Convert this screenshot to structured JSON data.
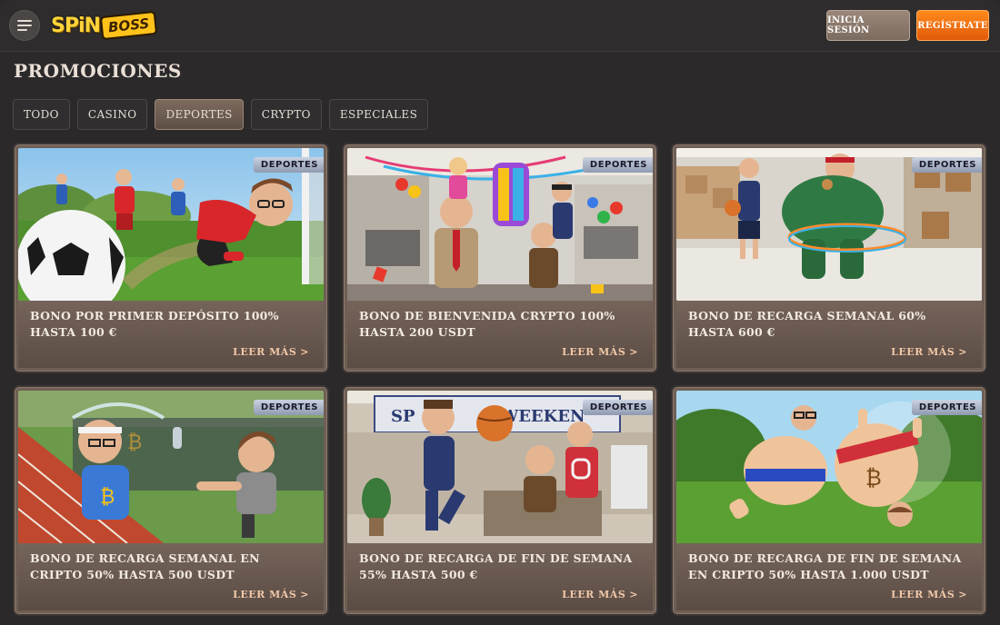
{
  "header": {
    "logo_main": "SPiN",
    "logo_sub": "BOSS",
    "login_label": "INICIA SESIÓN",
    "register_label": "REGÍSTRATE"
  },
  "page": {
    "title": "PROMOCIONES"
  },
  "tabs": [
    {
      "label": "TODO",
      "active": false
    },
    {
      "label": "CASINO",
      "active": false
    },
    {
      "label": "DEPORTES",
      "active": true
    },
    {
      "label": "CRYPTO",
      "active": false
    },
    {
      "label": "ESPECIALES",
      "active": false
    }
  ],
  "cards": [
    {
      "badge": "DEPORTES",
      "title": "BONO POR PRIMER DEPÓSITO 100% HASTA 100 €",
      "link": "LEER MÁS",
      "chev": ">"
    },
    {
      "badge": "DEPORTES",
      "title": "BONO DE BIENVENIDA CRYPTO 100% HASTA 200 USDT",
      "link": "LEER MÁS",
      "chev": ">"
    },
    {
      "badge": "DEPORTES",
      "title": "BONO DE RECARGA SEMANAL 60% HASTA 600 €",
      "link": "LEER MÁS",
      "chev": ">"
    },
    {
      "badge": "DEPORTES",
      "title": "BONO DE RECARGA SEMANAL EN CRIPTO 50% HASTA 500 USDT",
      "link": "LEER MÁS",
      "chev": ">"
    },
    {
      "badge": "DEPORTES",
      "title": "BONO DE RECARGA DE FIN DE SEMANA 55% HASTA 500 €",
      "link": "LEER MÁS",
      "chev": ">"
    },
    {
      "badge": "DEPORTES",
      "title": "BONO DE RECARGA DE FIN DE SEMANA EN CRIPTO 50% HASTA 1.000 USDT",
      "link": "LEER MÁS",
      "chev": ">"
    }
  ],
  "colors": {
    "accent_orange": "#ff7a14",
    "badge_bg": "#b7c0d2",
    "card_bg": "#6f5f55"
  },
  "icons": {
    "menu": "hamburger-icon",
    "link_chevron": "chevron-right-icon"
  }
}
